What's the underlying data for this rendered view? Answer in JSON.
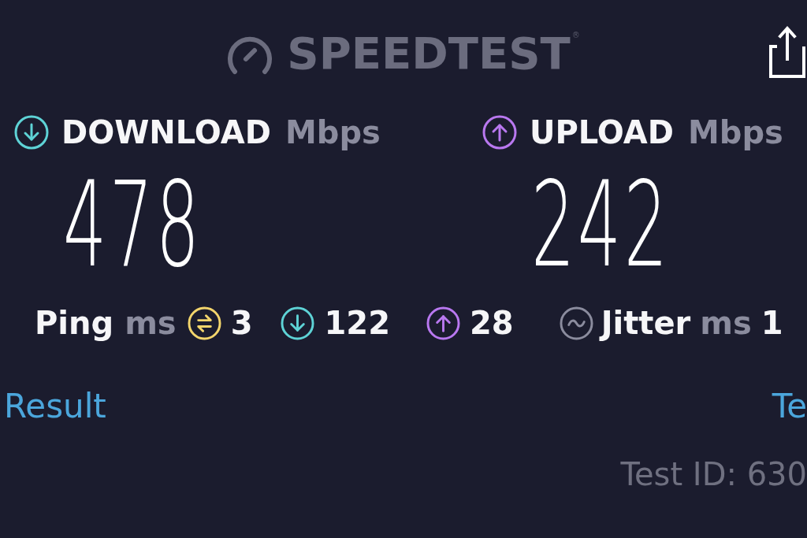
{
  "logo": {
    "text": "SPEEDTEST",
    "mark": "®"
  },
  "metrics": [
    {
      "kind": "download",
      "label": "DOWNLOAD",
      "unit": "Mbps",
      "value": "478",
      "color": "#5ed3d6"
    },
    {
      "kind": "upload",
      "label": "UPLOAD",
      "unit": "Mbps",
      "value": "242",
      "color": "#b978f0"
    }
  ],
  "ping": {
    "label": "Ping",
    "unit": "ms",
    "readings": [
      {
        "kind": "idle",
        "value": "3",
        "color": "#f3d56c"
      },
      {
        "kind": "download",
        "value": "122",
        "color": "#5ed3d6"
      },
      {
        "kind": "upload",
        "value": "28",
        "color": "#b978f0"
      }
    ]
  },
  "jitter": {
    "label": "Jitter",
    "unit": "ms",
    "value": "1"
  },
  "links": [
    {
      "label": "Result"
    },
    {
      "label": "Te"
    }
  ],
  "test_id": "Test ID: 630"
}
